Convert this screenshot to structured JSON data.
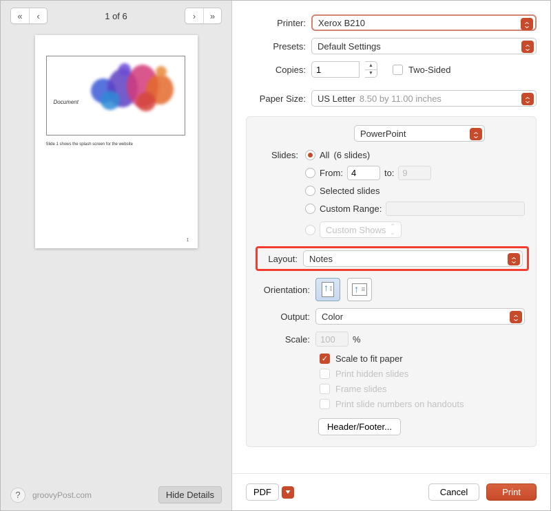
{
  "nav": {
    "page_indicator": "1 of 6"
  },
  "preview": {
    "doc_label": "Document",
    "note_text": "Slide 1 shows the splash screen for the website",
    "page_num": "1"
  },
  "left_footer": {
    "watermark": "groovyPost.com",
    "hide_details": "Hide Details"
  },
  "labels": {
    "printer": "Printer:",
    "presets": "Presets:",
    "copies": "Copies:",
    "two_sided": "Two-Sided",
    "paper_size": "Paper Size:",
    "slides": "Slides:",
    "layout": "Layout:",
    "orientation": "Orientation:",
    "output": "Output:",
    "scale": "Scale:"
  },
  "printer": {
    "value": "Xerox B210"
  },
  "presets": {
    "value": "Default Settings"
  },
  "copies": {
    "value": "1"
  },
  "paper_size": {
    "value": "US Letter",
    "detail": "8.50 by 11.00 inches"
  },
  "app_dropdown": {
    "value": "PowerPoint"
  },
  "slides": {
    "all_label": "All",
    "all_count": "(6 slides)",
    "from_label": "From:",
    "from_value": "4",
    "to_label": "to:",
    "to_value": "9",
    "selected_label": "Selected slides",
    "custom_range_label": "Custom Range:",
    "custom_shows_label": "Custom Shows"
  },
  "layout": {
    "value": "Notes"
  },
  "output": {
    "value": "Color"
  },
  "scale": {
    "value": "100",
    "percent": "%"
  },
  "options": {
    "fit_paper": "Scale to fit paper",
    "hidden": "Print hidden slides",
    "frame": "Frame slides",
    "numbers": "Print slide numbers on handouts"
  },
  "header_footer": "Header/Footer...",
  "footer": {
    "pdf": "PDF",
    "cancel": "Cancel",
    "print": "Print"
  }
}
